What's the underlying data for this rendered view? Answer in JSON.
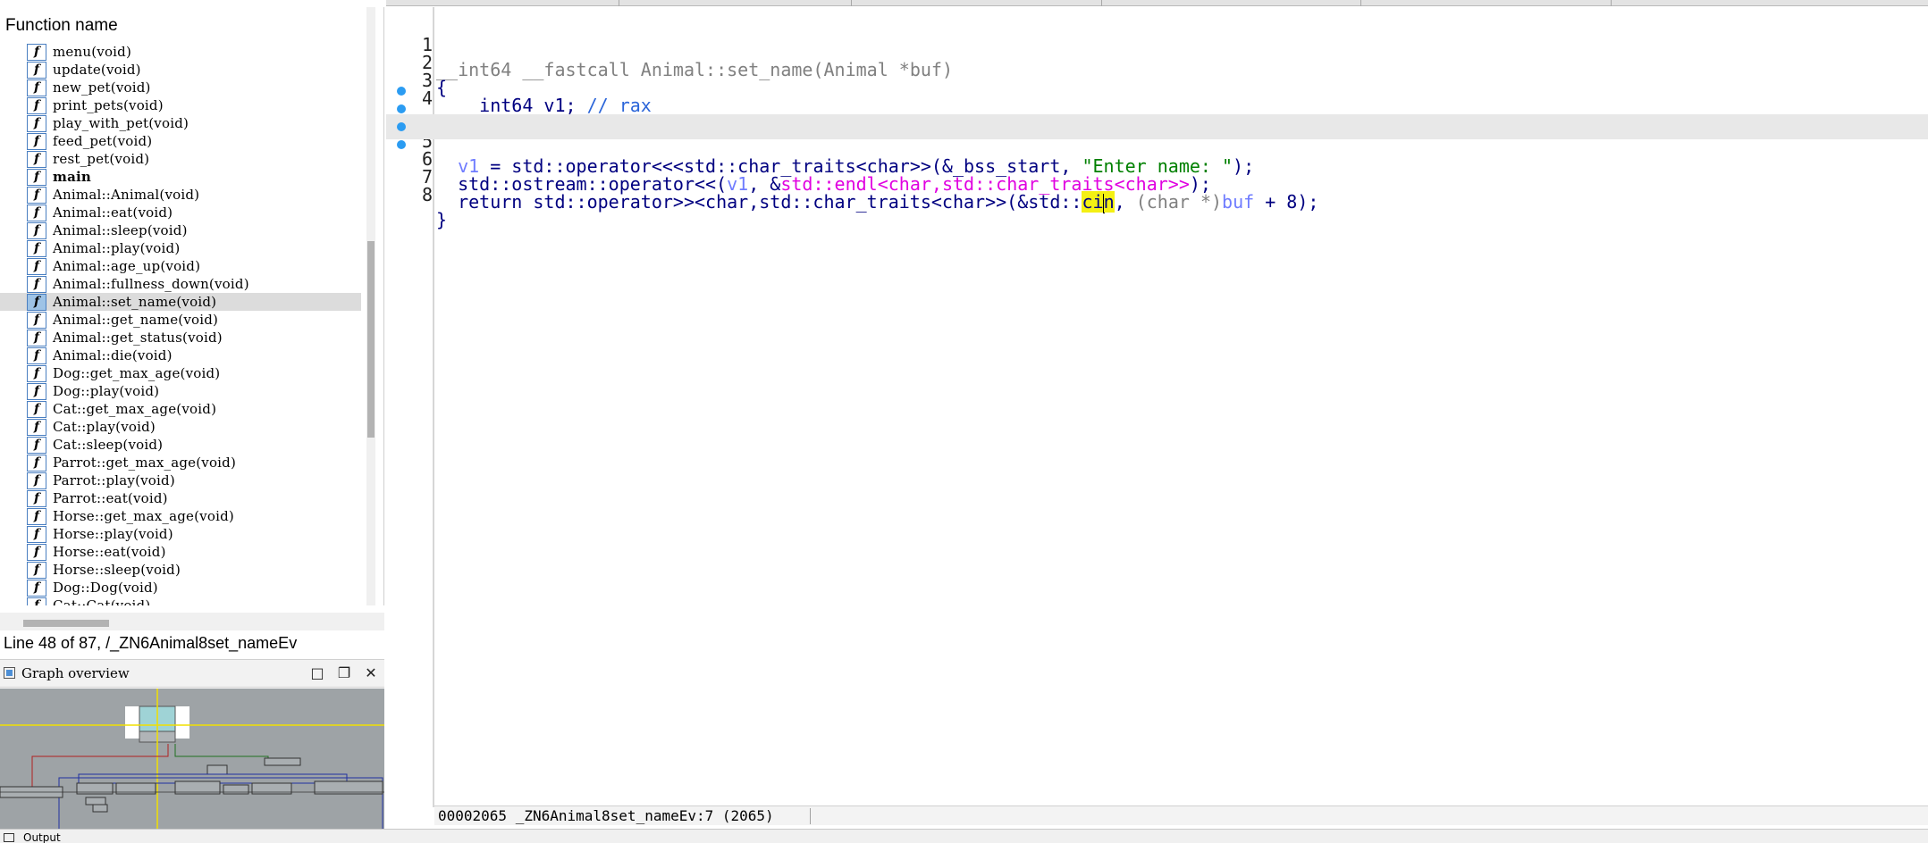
{
  "functions_panel": {
    "header": "Function name",
    "items": [
      {
        "label": "menu(void)"
      },
      {
        "label": "update(void)"
      },
      {
        "label": "new_pet(void)"
      },
      {
        "label": "print_pets(void)"
      },
      {
        "label": "play_with_pet(void)"
      },
      {
        "label": "feed_pet(void)"
      },
      {
        "label": "rest_pet(void)"
      },
      {
        "label": "main",
        "bold": true
      },
      {
        "label": "Animal::Animal(void)"
      },
      {
        "label": "Animal::eat(void)"
      },
      {
        "label": "Animal::sleep(void)"
      },
      {
        "label": "Animal::play(void)"
      },
      {
        "label": "Animal::age_up(void)"
      },
      {
        "label": "Animal::fullness_down(void)"
      },
      {
        "label": "Animal::set_name(void)",
        "selected": true
      },
      {
        "label": "Animal::get_name(void)"
      },
      {
        "label": "Animal::get_status(void)"
      },
      {
        "label": "Animal::die(void)"
      },
      {
        "label": "Dog::get_max_age(void)"
      },
      {
        "label": "Dog::play(void)"
      },
      {
        "label": "Cat::get_max_age(void)"
      },
      {
        "label": "Cat::play(void)"
      },
      {
        "label": "Cat::sleep(void)"
      },
      {
        "label": "Parrot::get_max_age(void)"
      },
      {
        "label": "Parrot::play(void)"
      },
      {
        "label": "Parrot::eat(void)"
      },
      {
        "label": "Horse::get_max_age(void)"
      },
      {
        "label": "Horse::play(void)"
      },
      {
        "label": "Horse::eat(void)"
      },
      {
        "label": "Horse::sleep(void)"
      },
      {
        "label": "Dog::Dog(void)"
      },
      {
        "label": "Cat::Cat(void)"
      }
    ],
    "icon_glyph": "f",
    "icon_name": "function-icon"
  },
  "line_info": "Line 48 of 87, /_ZN6Animal8set_nameEv",
  "graph_overview": {
    "title": "Graph overview",
    "buttons": {
      "minimize": "□",
      "restore": "❐",
      "close": "✕"
    }
  },
  "pseudocode": {
    "lines": [
      {
        "num": "1",
        "bp": false
      },
      {
        "num": "2",
        "bp": false,
        "text": "{"
      },
      {
        "num": "3",
        "bp": false
      },
      {
        "num": "4",
        "bp": false,
        "text": ""
      },
      {
        "num": "5",
        "bp": true
      },
      {
        "num": "6",
        "bp": true
      },
      {
        "num": "7",
        "bp": true,
        "current": true
      },
      {
        "num": "8",
        "bp": true,
        "text": "}"
      }
    ],
    "l1": {
      "type": "__int64 __fastcall Animal::set_name(",
      "param": "Animal *buf",
      "close": ")"
    },
    "l3": {
      "decl": "  __int64 v1; ",
      "comment": "// rax"
    },
    "l5": {
      "var": "  v1",
      "op": " = std::operator<<<std::char_traits<char>>(&_bss_start, ",
      "str": "\"Enter name: \"",
      "end": ");"
    },
    "l6": {
      "a": "  std::ostream::operator<<(",
      "var": "v1",
      "b": ", &",
      "endl": "std::endl<char,std::char_traits<char>>",
      "end": ");"
    },
    "l7": {
      "a": "  return std::operator>><char,std::char_traits<char>>(&std::",
      "hl1": "ci",
      "hl2": "n",
      "b": ", ",
      "cast": "(char *)",
      "var": "buf",
      "end": " + 8);"
    }
  },
  "status_bar": {
    "address": "00002065",
    "location": "_ZN6Animal8set_nameEv:7 (2065)"
  },
  "bottom": {
    "output_label": "Output"
  },
  "colors": {
    "keyword": "#000080",
    "string": "#008000",
    "variable": "#0000ff",
    "library": "#e000e0",
    "comment": "#2b65d9",
    "highlight": "#f4f014",
    "breakpoint": "#2b9cf2"
  }
}
